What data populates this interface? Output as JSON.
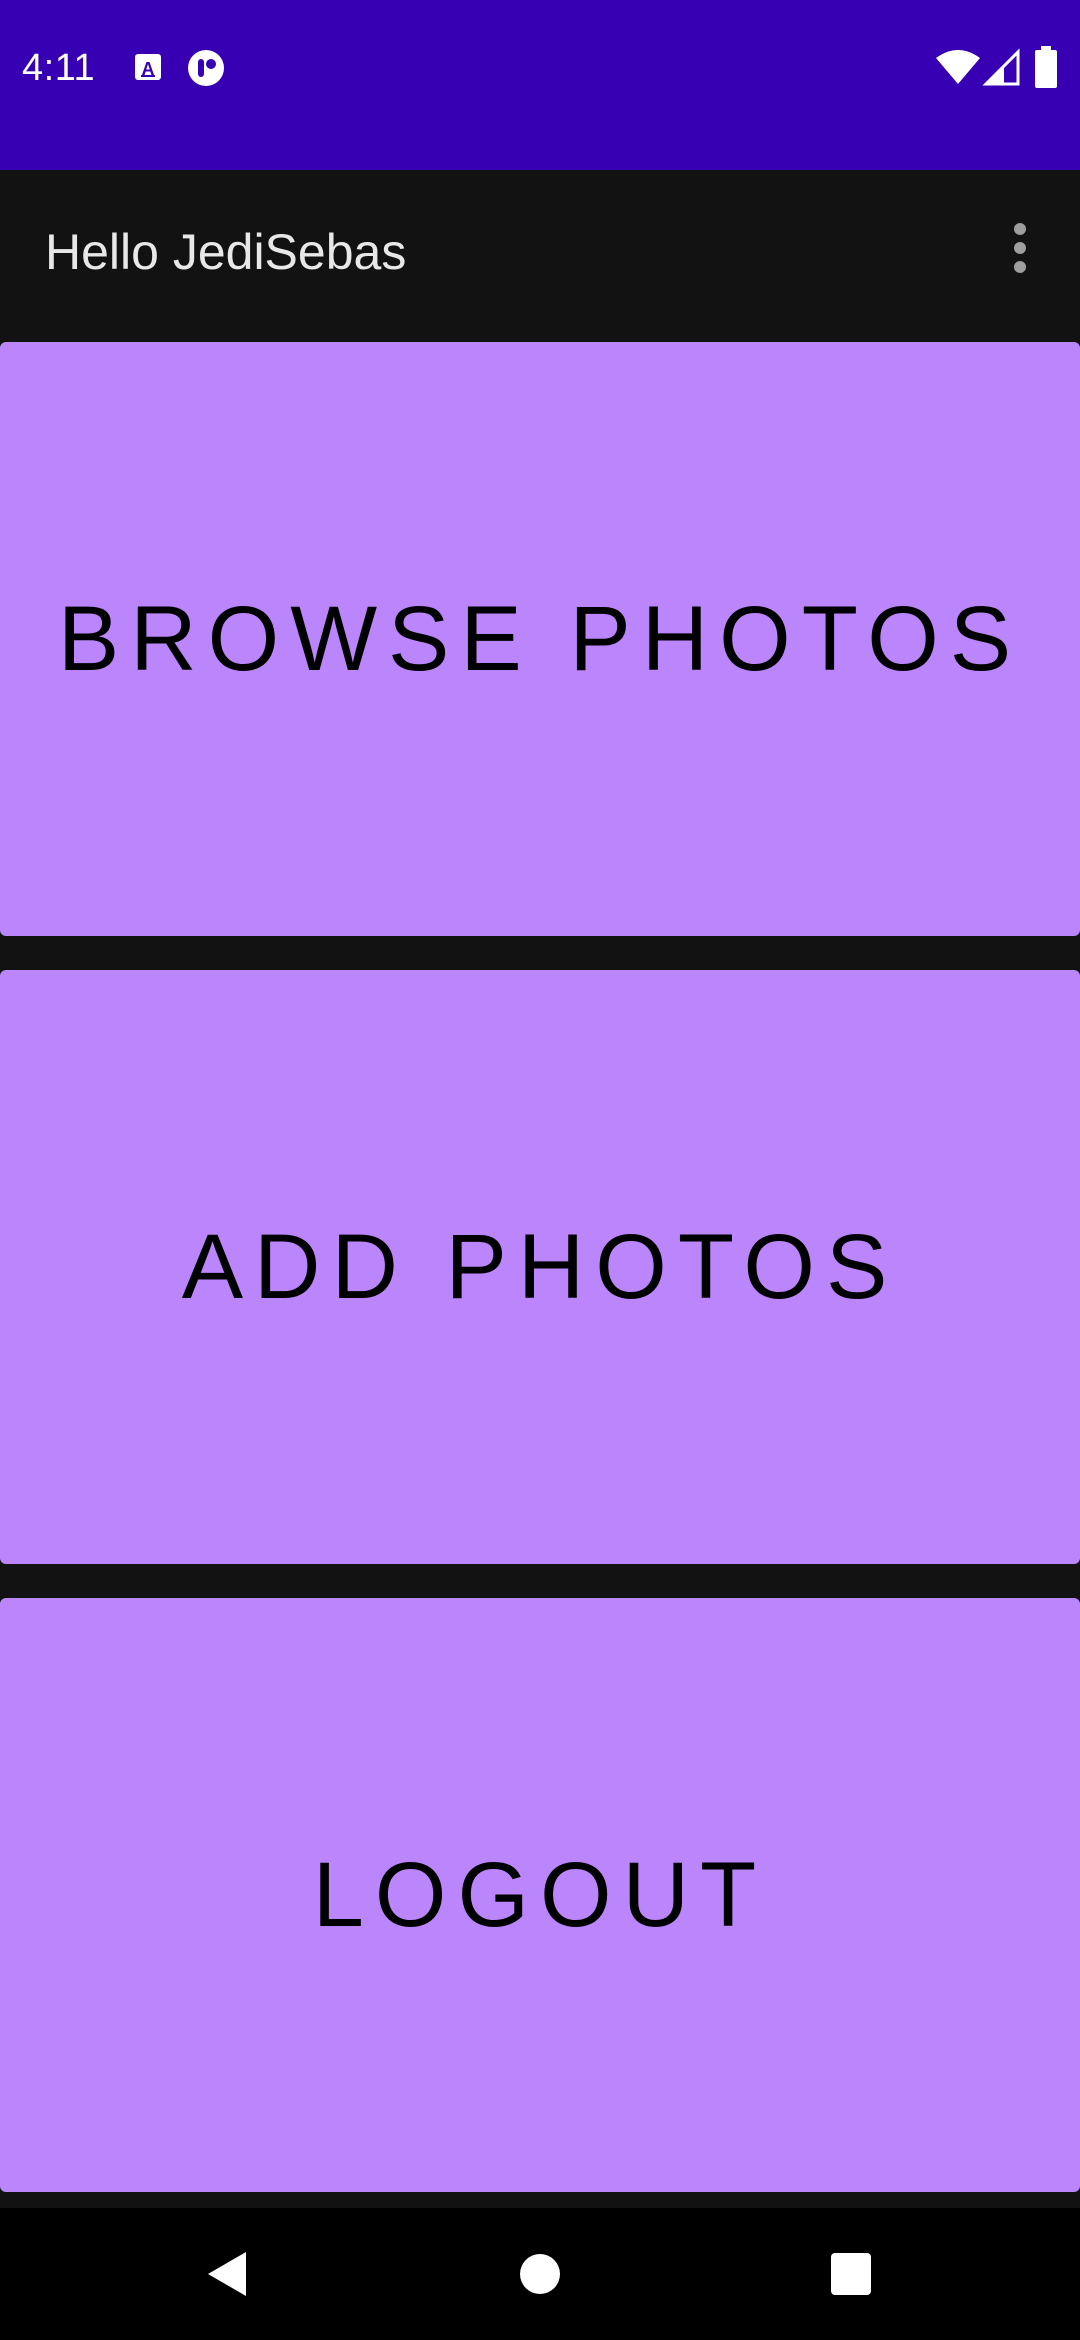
{
  "status_bar": {
    "time": "4:11",
    "background_color": "#3700b3",
    "left_icons": [
      "a-notification-icon",
      "circle-notification-icon"
    ],
    "right_icons": [
      "wifi-icon",
      "cellular-signal-icon",
      "battery-icon"
    ]
  },
  "app_bar": {
    "title": "Hello JediSebas",
    "menu_icon": "more-vert-icon"
  },
  "main": {
    "buttons": [
      {
        "label": "BROWSE PHOTOS"
      },
      {
        "label": "ADD PHOTOS"
      },
      {
        "label": "LOGOUT"
      }
    ],
    "button_color": "#bb86fc"
  },
  "nav_bar": {
    "icons": [
      "back-icon",
      "home-icon",
      "recents-icon"
    ]
  }
}
